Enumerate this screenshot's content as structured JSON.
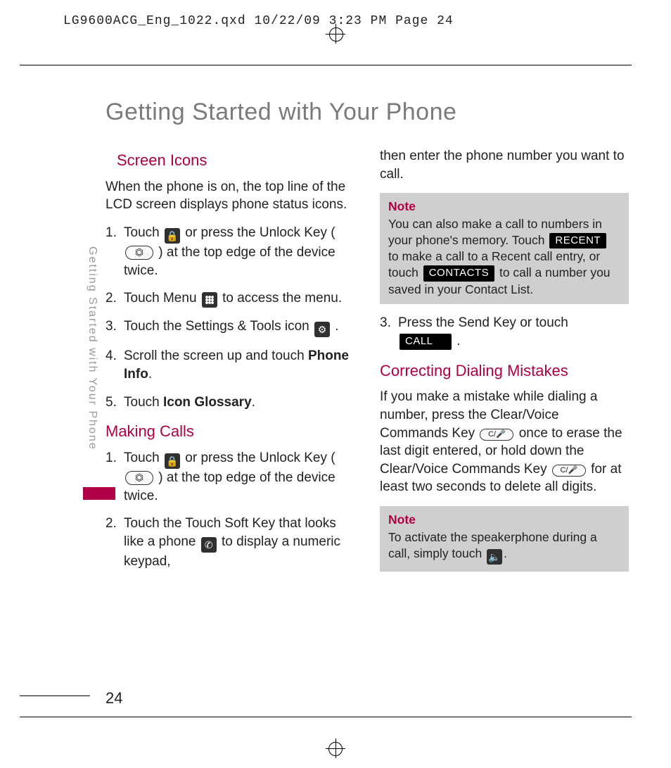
{
  "print_header": "LG9600ACG_Eng_1022.qxd  10/22/09  3:23 PM  Page 24",
  "page_title": "Getting Started with Your Phone",
  "sidebar_label": "Getting Started with Your Phone",
  "page_number": "24",
  "colors": {
    "accent": "#b00045",
    "note_bg": "#cfcfcf"
  },
  "left": {
    "sec1_title": "Screen Icons",
    "sec1_intro": "When the phone is on, the top line of the LCD screen displays phone status icons.",
    "step1a": "Touch ",
    "step1b": " or press the Unlock Key ( ",
    "step1c": " ) at the top edge of the device twice.",
    "step2a": "Touch Menu ",
    "step2b": " to access the menu.",
    "step3a": "Touch the Settings & Tools icon ",
    "step3b": ".",
    "step4a": "Scroll the screen up and touch ",
    "step4_bold": "Phone Info",
    "step4b": ".",
    "step5a": "Touch ",
    "step5_bold": "Icon Glossary",
    "step5b": ".",
    "sec2_title": "Making Calls",
    "m_step1a": "Touch ",
    "m_step1b": " or press the Unlock Key ( ",
    "m_step1c": " ) at the top edge of the device twice.",
    "m_step2a": "Touch the Touch Soft Key that looks like a phone ",
    "m_step2b": " to display a numeric keypad,"
  },
  "right": {
    "cont": "then enter the phone number you want to call.",
    "note1_title": "Note",
    "note1_a": "You can also make a call to numbers in your phone's memory. Touch ",
    "note1_recent": "RECENT",
    "note1_b": " to make a call to a Recent call entry, or touch ",
    "note1_contacts": "CONTACTS",
    "note1_c": " to call a number you saved in your Contact List.",
    "step3a": "Press the Send Key or touch ",
    "step3_call": "CALL",
    "step3b": " .",
    "sec3_title": "Correcting Dialing Mistakes",
    "corr_a": "If you make a mistake while dialing a number, press  the Clear/Voice Commands Key ",
    "corr_b": " once to erase the last digit entered, or hold down the Clear/Voice Commands Key ",
    "corr_c": "  for at least two seconds to delete all digits.",
    "note2_title": "Note",
    "note2_a": "To activate the speakerphone during a call, simply touch ",
    "note2_b": "."
  },
  "icons": {
    "lock": "🔒",
    "unlock_key": "⏣",
    "gear": "⚙",
    "phone": "✆",
    "clear_key": "C/🎤",
    "speaker": "🔈"
  }
}
